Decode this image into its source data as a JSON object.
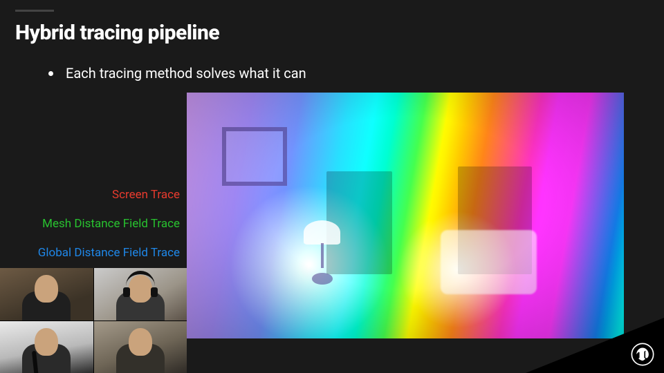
{
  "slide": {
    "title": "Hybrid tracing pipeline",
    "bullets": [
      "Each tracing method solves what it can"
    ],
    "trace_labels": [
      {
        "text": "Screen Trace",
        "color": "#e83b2e"
      },
      {
        "text": "Mesh Distance Field Trace",
        "color": "#28c22f"
      },
      {
        "text": "Global Distance Field Trace",
        "color": "#1f87e8"
      }
    ]
  },
  "visualization": {
    "description": "interior-room-normals-debug",
    "depicts": [
      "picture-frame",
      "bookshelf",
      "bookshelf",
      "lamp",
      "armchair",
      "side-table"
    ],
    "color_map": "world-space-normal"
  },
  "participants": [
    {
      "position": "top-left",
      "has_headset": false,
      "has_mic": false
    },
    {
      "position": "top-right",
      "has_headset": true,
      "has_mic": false
    },
    {
      "position": "bottom-left",
      "has_headset": false,
      "has_mic": true
    },
    {
      "position": "bottom-right",
      "has_headset": false,
      "has_mic": false
    }
  ],
  "branding": {
    "logo": "unreal-engine"
  },
  "colors": {
    "background": "#1a1a1a",
    "text": "#ffffff",
    "accent_bar": "#444444"
  }
}
